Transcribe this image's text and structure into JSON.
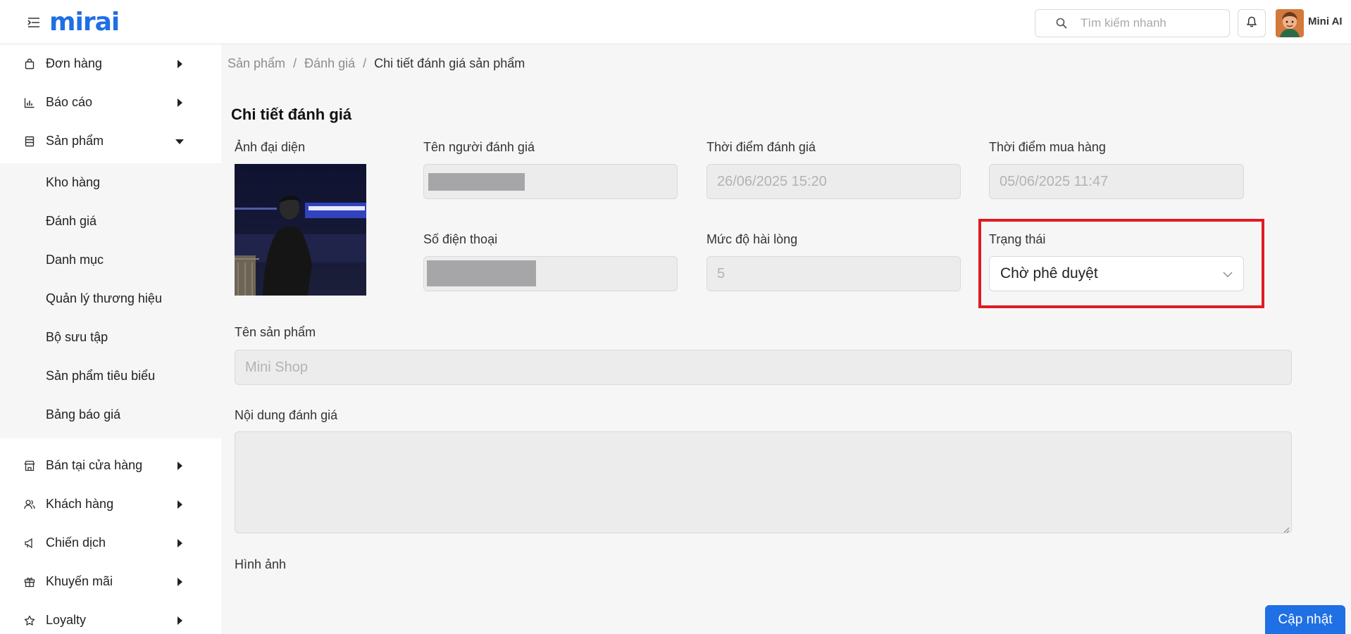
{
  "header": {
    "logo_text": "mirai",
    "search_placeholder": "Tìm kiếm nhanh",
    "user_name": "Mini AI"
  },
  "sidebar": {
    "items": [
      {
        "label": "Đơn hàng",
        "icon": "bag-icon"
      },
      {
        "label": "Báo cáo",
        "icon": "chart-icon"
      },
      {
        "label": "Sản phẩm",
        "icon": "product-icon",
        "expanded": true
      },
      {
        "label": "Bán tại cửa hàng",
        "icon": "store-icon"
      },
      {
        "label": "Khách hàng",
        "icon": "customers-icon"
      },
      {
        "label": "Chiến dịch",
        "icon": "megaphone-icon"
      },
      {
        "label": "Khuyến mãi",
        "icon": "gift-icon"
      },
      {
        "label": "Loyalty",
        "icon": "star-icon"
      }
    ],
    "submenu": [
      {
        "label": "Kho hàng"
      },
      {
        "label": "Đánh giá"
      },
      {
        "label": "Danh mục"
      },
      {
        "label": "Quản lý thương hiệu"
      },
      {
        "label": "Bộ sưu tập"
      },
      {
        "label": "Sản phẩm tiêu biểu"
      },
      {
        "label": "Bảng báo giá"
      }
    ]
  },
  "breadcrumb": {
    "items": [
      "Sản phẩm",
      "Đánh giá"
    ],
    "separator": "/",
    "current": "Chi tiết đánh giá sản phẩm"
  },
  "page": {
    "title": "Chi tiết đánh giá"
  },
  "form": {
    "avatar_label": "Ảnh đại diện",
    "reviewer_name_label": "Tên người đánh giá",
    "review_time_label": "Thời điểm đánh giá",
    "review_time_value": "26/06/2025 15:20",
    "purchase_time_label": "Thời điểm mua hàng",
    "purchase_time_value": "05/06/2025 11:47",
    "phone_label": "Số điện thoại",
    "satisfaction_label": "Mức độ hài lòng",
    "satisfaction_value": "5",
    "status_label": "Trạng thái",
    "status_value": "Chờ phê duyệt",
    "product_name_label": "Tên sản phẩm",
    "product_name_value": "Mini Shop",
    "review_content_label": "Nội dung đánh giá",
    "review_content_value": "",
    "images_label": "Hình ảnh"
  },
  "actions": {
    "update_label": "Cập nhật"
  },
  "colors": {
    "accent": "#1f6fe5",
    "highlight": "#e01b24",
    "disabled_bg": "#ececec",
    "redaction": "#a6a6a8"
  }
}
